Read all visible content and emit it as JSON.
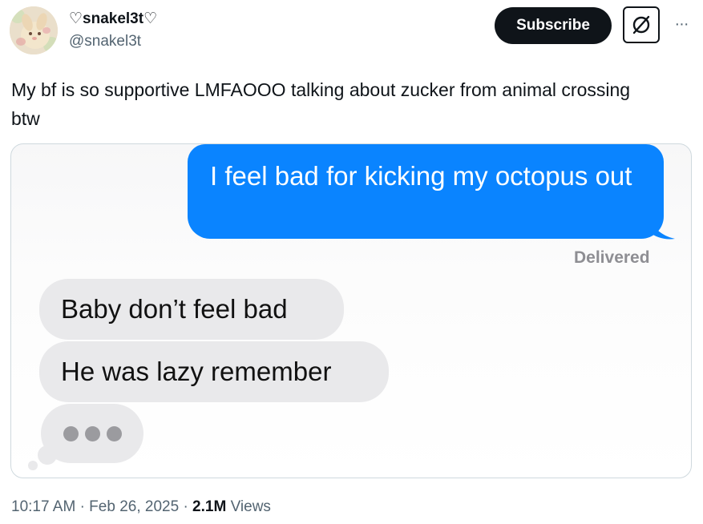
{
  "author": {
    "display_name": "♡snakel3t♡",
    "handle": "@snakel3t"
  },
  "actions": {
    "subscribe_label": "Subscribe",
    "grok_icon": "grok-icon",
    "more_icon": "more-horizontal-icon",
    "more_label": "···"
  },
  "tweet": {
    "text": "My bf is so supportive LMFAOOO talking about zucker from animal crossing btw"
  },
  "media": {
    "messages": [
      {
        "from": "me",
        "text": "I feel bad for kicking my octopus out"
      },
      {
        "from": "them",
        "text": "Baby don’t feel bad"
      },
      {
        "from": "them",
        "text": "He was lazy remember"
      }
    ],
    "status": "Delivered",
    "typing_indicator": "typing-dots-icon",
    "colors": {
      "outgoing_bubble": "#0a84ff",
      "incoming_bubble": "#e9e9eb",
      "status_text": "#8e8e93"
    }
  },
  "meta": {
    "time": "10:17 AM",
    "separator": "·",
    "date": "Feb 26, 2025",
    "views_count": "2.1M",
    "views_label": "Views"
  }
}
